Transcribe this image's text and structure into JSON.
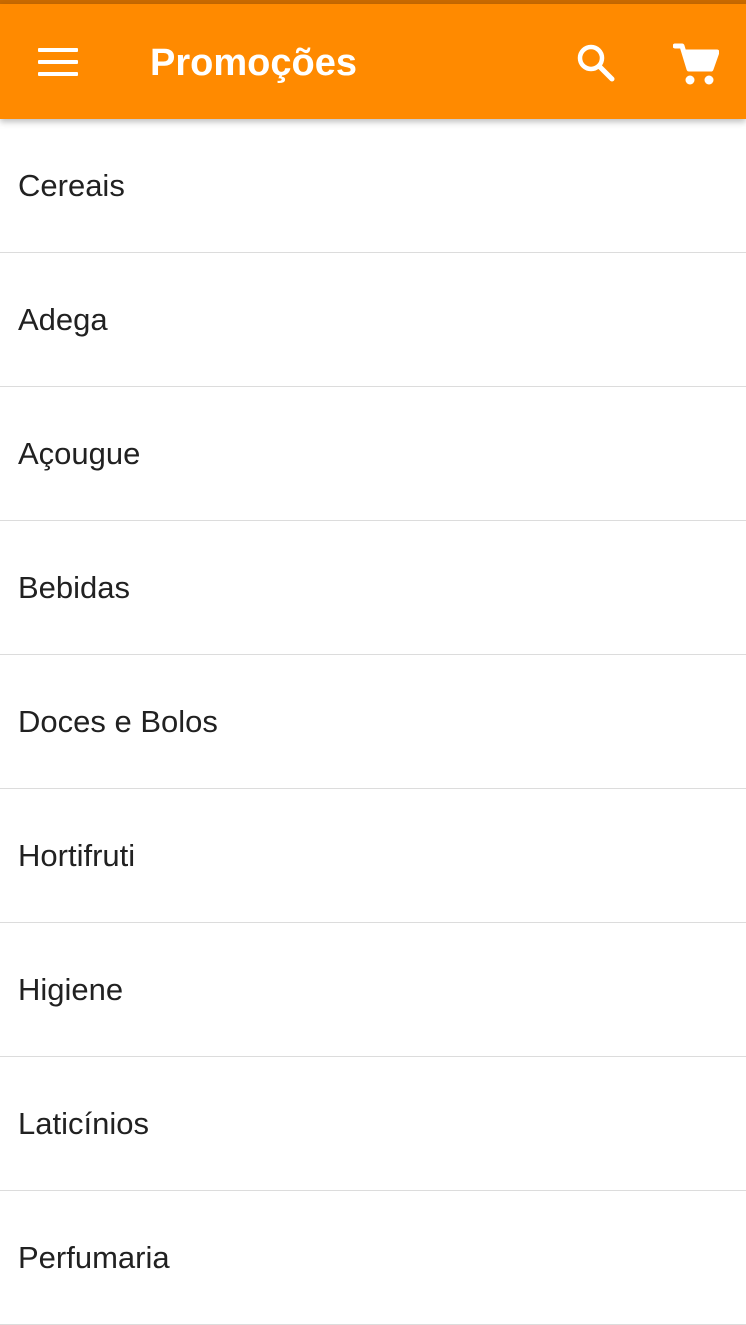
{
  "app_bar": {
    "title": "Promoções",
    "menu_icon": "hamburger-menu-icon",
    "search_icon": "search-icon",
    "cart_icon": "shopping-cart-icon",
    "color": "#ff8a00"
  },
  "categories": [
    {
      "label": "Cereais"
    },
    {
      "label": "Adega"
    },
    {
      "label": "Açougue"
    },
    {
      "label": "Bebidas"
    },
    {
      "label": "Doces e Bolos"
    },
    {
      "label": "Hortifruti"
    },
    {
      "label": "Higiene"
    },
    {
      "label": "Laticínios"
    },
    {
      "label": "Perfumaria"
    }
  ]
}
